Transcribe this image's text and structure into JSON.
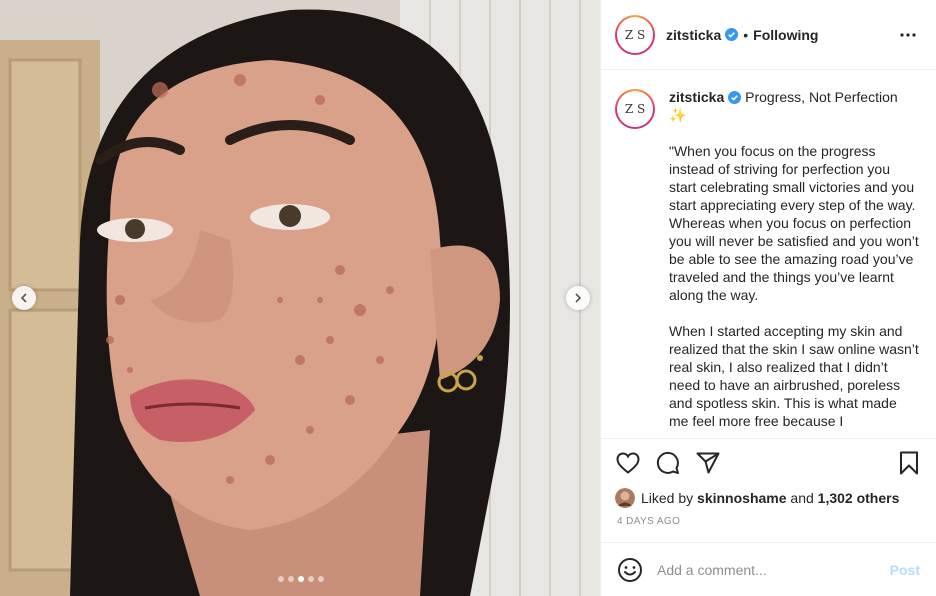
{
  "post": {
    "username": "zitsticka",
    "avatar_text": "Z S",
    "verified_icon": "verified-badge-icon",
    "separator": "•",
    "follow_status": "Following",
    "more_icon": "more-options-icon",
    "caption": {
      "title": "Progress, Not Perfection",
      "title_emoji": "✨",
      "paragraphs": [
        "\"When you focus on the progress instead of striving for perfection you start celebrating small victories and you start appreciating every step of the way. Whereas when you focus on perfection you will never be satisfied and you won’t be able to see the amazing road you’ve traveled and the things you’ve learnt along the way.",
        "When I started accepting my skin and realized that the skin I saw online wasn’t real skin, I also realized that I didn’t need to have an airbrushed, poreless and spotless skin. This is what made me feel more free because I"
      ]
    },
    "likes": {
      "prefix": "Liked by",
      "liker": "skinnoshame",
      "connector": "and",
      "others": "1,302 others"
    },
    "timestamp": "4 DAYS AGO",
    "comment": {
      "placeholder": "Add a comment...",
      "post_label": "Post"
    },
    "carousel": {
      "slide_count": 5,
      "active_index": 2
    }
  },
  "colors": {
    "accent_blue": "#3897f0",
    "post_button_disabled": "#b2dffc",
    "muted_text": "#8e8e8e",
    "border": "#efefef"
  }
}
